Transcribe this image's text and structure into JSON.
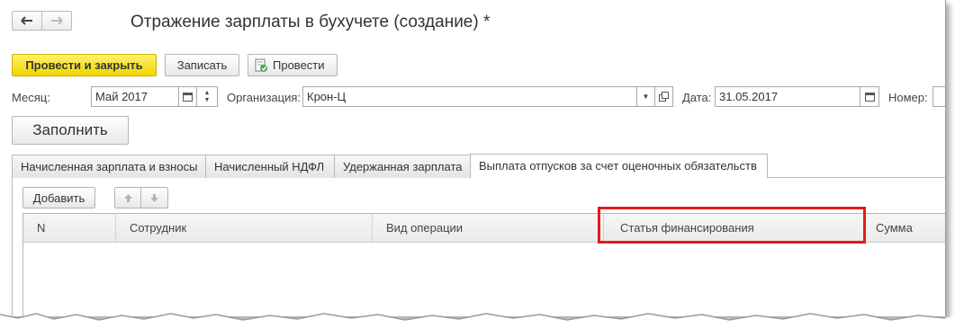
{
  "window": {
    "title": "Отражение зарплаты в бухучете (создание) *",
    "nav_back_icon": "arrow-left-icon",
    "nav_forward_icon": "arrow-right-icon"
  },
  "toolbar": {
    "post_and_close": "Провести и закрыть",
    "save": "Записать",
    "post": "Провести",
    "post_icon": "document-post-icon"
  },
  "form": {
    "month_label": "Месяц:",
    "month_value": "Май 2017",
    "org_label": "Организация:",
    "org_value": "Крон-Ц",
    "date_label": "Дата:",
    "date_value": "31.05.2017",
    "number_label": "Номер:",
    "fill_button": "Заполнить"
  },
  "tabs": [
    {
      "label": "Начисленная зарплата и взносы",
      "active": false
    },
    {
      "label": "Начисленный НДФЛ",
      "active": false
    },
    {
      "label": "Удержанная зарплата",
      "active": false
    },
    {
      "label": "Выплата отпусков за счет оценочных обязательств",
      "active": true
    }
  ],
  "table": {
    "add_button": "Добавить",
    "columns": [
      "N",
      "Сотрудник",
      "Вид операции",
      "Статья финансирования",
      "Сумма"
    ],
    "rows": []
  },
  "colors": {
    "primary_button": "#f5dc1e",
    "highlight_border": "#e21b1b"
  }
}
